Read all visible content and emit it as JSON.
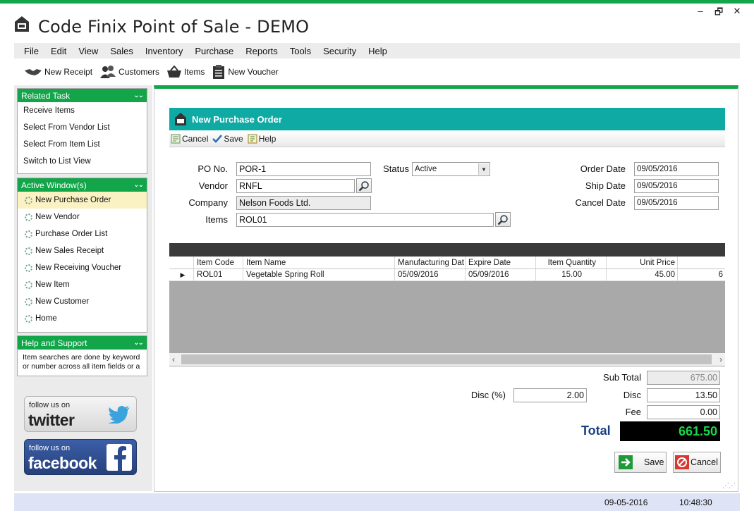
{
  "window": {
    "title": "Code Finix Point of Sale - DEMO",
    "controls": [
      "–",
      "🗗",
      "✕"
    ]
  },
  "menu": [
    "File",
    "Edit",
    "View",
    "Sales",
    "Inventory",
    "Purchase",
    "Reports",
    "Tools",
    "Security",
    "Help"
  ],
  "toolbar": {
    "new_receipt": "New Receipt",
    "customers": "Customers",
    "items": "Items",
    "new_voucher": "New Voucher"
  },
  "sidebar": {
    "related_task": {
      "title": "Related Task",
      "items": [
        "Receive Items",
        "Select From Vendor List",
        "Select From Item List",
        "Switch to List View"
      ]
    },
    "active_windows": {
      "title": "Active Window(s)",
      "items": [
        "New Purchase Order",
        "New Vendor",
        "Purchase Order List",
        "New Sales Receipt",
        "New Receiving Voucher",
        "New Item",
        "New Customer",
        "Home"
      ]
    },
    "help": {
      "title": "Help and Support",
      "text": "Item searches are done by keyword or number across all item fields or a selected field (see the list"
    },
    "twitter": {
      "small": "follow us on",
      "big": "twitter"
    },
    "facebook": {
      "small": "follow us on",
      "big": "facebook"
    }
  },
  "form": {
    "header": "New Purchase Order",
    "toolbar": {
      "cancel": "Cancel",
      "save": "Save",
      "help": "Help"
    },
    "po_no_label": "PO No.",
    "po_no": "POR-1",
    "status_label": "Status",
    "status": "Active",
    "vendor_label": "Vendor",
    "vendor": "RNFL",
    "company_label": "Company",
    "company": "Nelson Foods Ltd.",
    "items_label": "Items",
    "items": "ROL01",
    "order_date_label": "Order Date",
    "order_date": "09/05/2016",
    "ship_date_label": "Ship Date",
    "ship_date": "09/05/2016",
    "cancel_date_label": "Cancel Date",
    "cancel_date": "09/05/2016"
  },
  "grid": {
    "columns": [
      "Item Code",
      "Item Name",
      "Manufacturing Dat",
      "Expire Date",
      "Item Quantity",
      "Unit Price"
    ],
    "rows": [
      {
        "code": "ROL01",
        "name": "Vegetable Spring Roll",
        "mfg": "05/09/2016",
        "exp": "05/09/2016",
        "qty": "15.00",
        "price": "45.00",
        "overflow": "6"
      }
    ]
  },
  "totals": {
    "sub_total_label": "Sub Total",
    "sub_total": "675.00",
    "disc_pct_label": "Disc (%)",
    "disc_pct": "2.00",
    "disc_label": "Disc",
    "disc": "13.50",
    "fee_label": "Fee",
    "fee": "0.00",
    "total_label": "Total",
    "total": "661.50"
  },
  "buttons": {
    "save": "Save",
    "cancel": "Cancel"
  },
  "status": {
    "date": "09-05-2016",
    "time": "10:48:30"
  },
  "colors": {
    "accent": "#12a54a",
    "header_teal": "#10aaa5",
    "total_green": "#19d64a",
    "total_blue": "#1a3e86"
  }
}
